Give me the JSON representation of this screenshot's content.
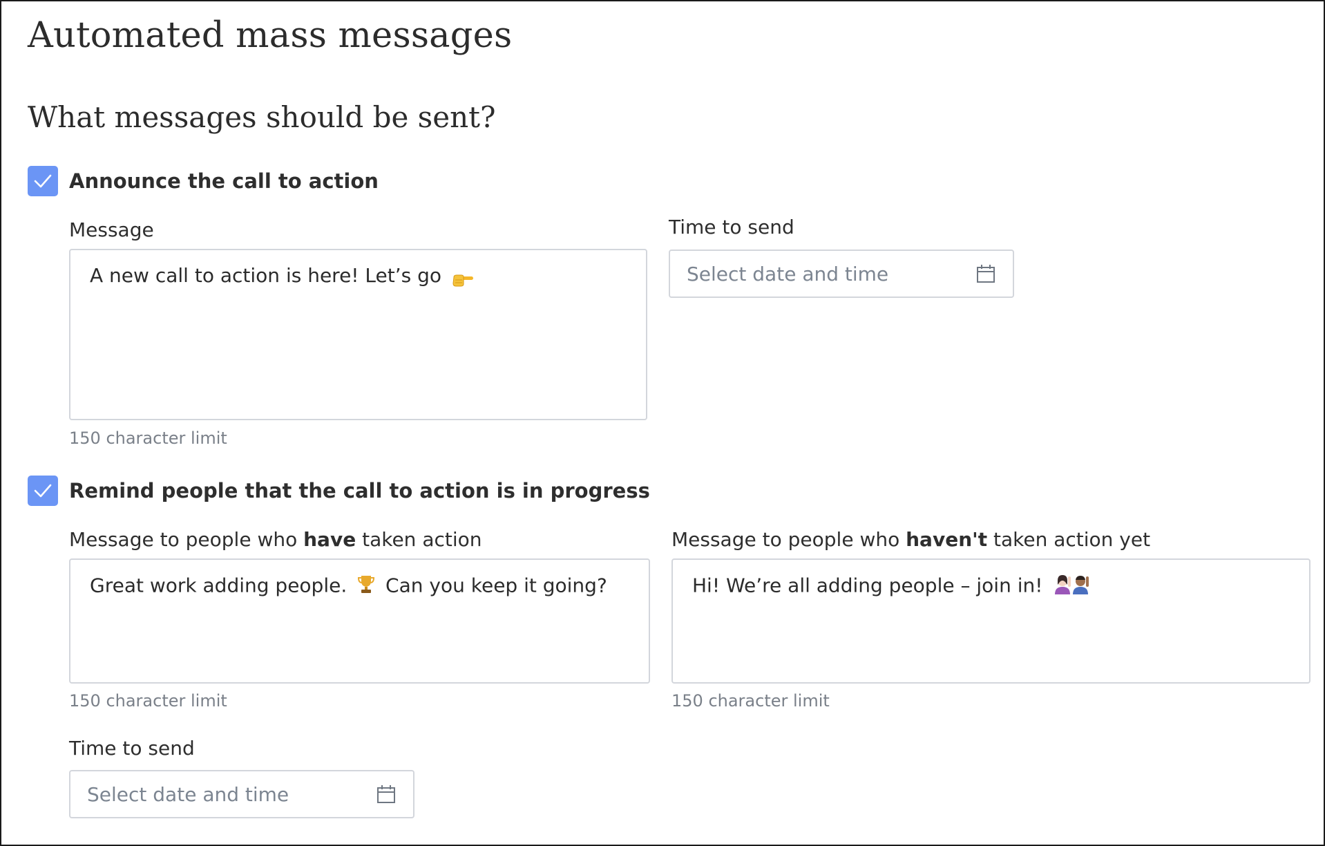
{
  "page": {
    "title": "Automated mass messages",
    "subtitle": "What messages should be sent?"
  },
  "announce": {
    "checkbox_label": "Announce the call to action",
    "checked": true,
    "message_label": "Message",
    "message_value": "A new call to action is here! Let’s go",
    "message_emoji": "pointing-right-icon",
    "hint": "150 character limit",
    "time_label": "Time to send",
    "time_placeholder": "Select date and time"
  },
  "remind": {
    "checkbox_label": "Remind people that the call to action is in progress",
    "checked": true,
    "have": {
      "label_prefix": "Message to people who ",
      "label_bold": "have",
      "label_suffix": " taken action",
      "value_before": "Great work adding people.",
      "value_after": "Can you keep it going?",
      "emoji": "trophy-icon",
      "hint": "150 character limit"
    },
    "havent": {
      "label_prefix": "Message to people who ",
      "label_bold": "haven't",
      "label_suffix": " taken action yet",
      "value": "Hi! We’re all adding people – join in!",
      "emoji": "raising-hands-people-icon",
      "hint": "150 character limit"
    },
    "time_label": "Time to send",
    "time_placeholder": "Select date and time"
  },
  "colors": {
    "checkbox": "#6b95f5",
    "border": "#d3d6dc",
    "hint": "#7a8089",
    "placeholder": "#7c8591"
  }
}
